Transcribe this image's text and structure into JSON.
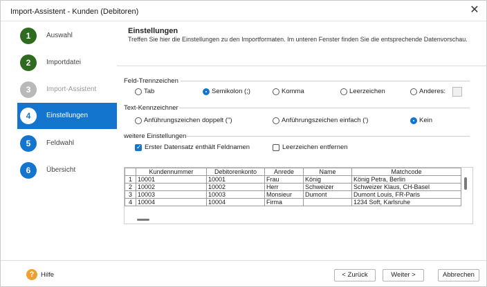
{
  "window": {
    "title": "Import-Assistent - Kunden (Debitoren)",
    "close_glyph": "✕"
  },
  "sidebar": {
    "steps": [
      {
        "num": "1",
        "label": "Auswahl"
      },
      {
        "num": "2",
        "label": "Importdatei"
      },
      {
        "num": "3",
        "label": "Import-Assistent"
      },
      {
        "num": "4",
        "label": "Einstellungen"
      },
      {
        "num": "5",
        "label": "Feldwahl"
      },
      {
        "num": "6",
        "label": "Übersicht"
      }
    ]
  },
  "header": {
    "title": "Einstellungen",
    "description": "Treffen Sie hier die Einstellungen zu den Importformaten. Im unteren Fenster finden Sie die entsprechende Datenvorschau."
  },
  "separator": {
    "label": "Feld-Trennzeichen",
    "options": [
      "Tab",
      "Semikolon (;)",
      "Komma",
      "Leerzeichen",
      "Anderes:"
    ],
    "selected": "Semikolon (;)"
  },
  "text_qualifier": {
    "label": "Text-Kennzeichner",
    "options": [
      "Anführungszeichen doppelt (\")",
      "Anführungszeichen einfach (')",
      "Kein"
    ],
    "selected": "Kein"
  },
  "more_settings": {
    "label": "weitere Einstellungen",
    "first_row_names": {
      "label": "Erster Datensatz enthält Feldnamen",
      "checked": true
    },
    "trim_spaces": {
      "label": "Leerzeichen entfernen",
      "checked": false
    }
  },
  "preview": {
    "columns": [
      "",
      "Kundennummer",
      "Debitorenkonto",
      "Anrede",
      "Name",
      "Matchcode"
    ],
    "rows": [
      [
        "1",
        "10001",
        "10001",
        "Frau",
        "König",
        "König Petra, Berlin"
      ],
      [
        "2",
        "10002",
        "10002",
        "Herr",
        "Schweizer",
        "Schweizer Klaus, CH-Basel"
      ],
      [
        "3",
        "10003",
        "10003",
        "Monsieur",
        "Dumont",
        "Dumont Louis, FR-Paris"
      ],
      [
        "4",
        "10004",
        "10004",
        "Firma",
        "",
        "1234 Soft, Karlsruhe"
      ]
    ]
  },
  "footer": {
    "help_icon": "?",
    "help_label": "Hilfe",
    "back_label": "< Zurück",
    "next_label": "Weiter >",
    "cancel_label": "Abbrechen"
  },
  "colors": {
    "accent": "#1475cf",
    "done": "#2e6b1f",
    "disabled": "#b9b9b9",
    "help": "#f0a030"
  }
}
